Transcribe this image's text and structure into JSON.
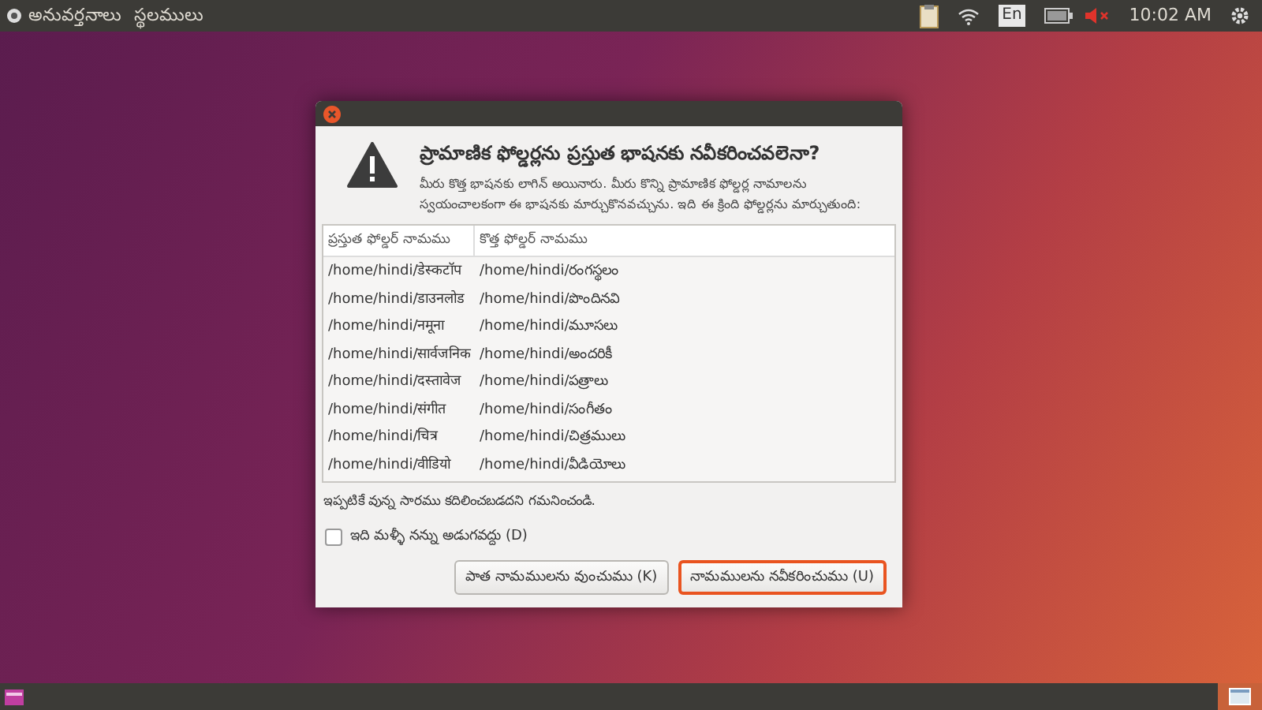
{
  "top_bar": {
    "menus": [
      "అనువర్తనాలు",
      "స్థలములు"
    ],
    "clock": "10:02 AM",
    "keyboard": "En",
    "volume_muted": true
  },
  "dialog": {
    "heading": "ప్రామాణిక ఫోల్డర్లను ప్రస్తుత భాషనకు నవీకరించవలెనా?",
    "message": "మీరు కొత్త భాషనకు లాగిన్ అయినారు. మీరు కొన్ని ప్రామాణిక ఫోల్డర్ల నామాలను స్వయంచాలకంగా ఈ భాషనకు మార్చుకొనవచ్చును. ఇది ఈ క్రింది ఫోల్డర్లను మార్చుతుంది:",
    "table": {
      "columns": [
        "ప్రస్తుత ఫోల్డర్ నామము",
        "కొత్త ఫోల్డర్ నామము"
      ],
      "rows": [
        [
          "/home/hindi/डेस्कटॉप",
          "/home/hindi/రంగస్థలం"
        ],
        [
          "/home/hindi/डाउनलोड",
          "/home/hindi/పొందినవి"
        ],
        [
          "/home/hindi/नमूना",
          "/home/hindi/మూసలు"
        ],
        [
          "/home/hindi/सार्वजनिक",
          "/home/hindi/అందరికీ"
        ],
        [
          "/home/hindi/दस्तावेज",
          "/home/hindi/పత్రాలు"
        ],
        [
          "/home/hindi/संगीत",
          "/home/hindi/సంగీతం"
        ],
        [
          "/home/hindi/चित्र",
          "/home/hindi/చిత్రములు"
        ],
        [
          "/home/hindi/वीडियो",
          "/home/hindi/వీడియోలు"
        ]
      ]
    },
    "note": "ఇప్పటికే వున్న సారము కదిలించబడదని గమనించండి.",
    "dont_ask": {
      "label": "ఇది మళ్ళీ నన్ను అడుగవద్దు (D)",
      "checked": false
    },
    "buttons": [
      {
        "label": "పాత నామములను వుంచుము (K)",
        "selected": false
      },
      {
        "label": "నామములను నవీకరించుము (U)",
        "selected": true
      }
    ]
  }
}
